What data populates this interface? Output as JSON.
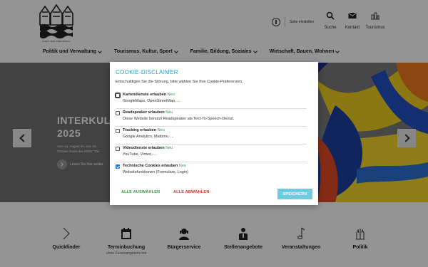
{
  "header": {
    "logo_text": "STADT BAD KREUZNACH",
    "accessibility_label": "Seite einstellen",
    "quick": [
      {
        "label": "Suche",
        "icon": "search-icon"
      },
      {
        "label": "Kontakt",
        "icon": "mail-icon"
      },
      {
        "label": "Tourismus",
        "icon": "tourism-icon"
      }
    ],
    "nav": [
      {
        "label": "Politik und Verwaltung"
      },
      {
        "label": "Tourismus, Kultur, Sport"
      },
      {
        "label": "Familie, Bildung, Soziales"
      },
      {
        "label": "Wirtschaft, Bauen, Wohnen"
      }
    ]
  },
  "hero": {
    "title_line1": "INTERKULT",
    "title_line2": "2025",
    "sub_line1": "Vom 14. August bis zum 10.",
    "sub_line2": "Oktober findet das Motto \"Tan",
    "more_label": "Lesen Sie hier weiter",
    "colors": {
      "yellow": "#f4d21c",
      "blue": "#1d3fa3",
      "red": "#e23a26",
      "orange": "#ef7a1c"
    }
  },
  "bottom_links": [
    {
      "label": "Quickfinder",
      "sub": "",
      "icon": "chevron-right-icon"
    },
    {
      "label": "Terminbuchung",
      "sub": "ohne Zusatzangebots mit",
      "icon": "calendar-icon"
    },
    {
      "label": "Bürgerservice",
      "sub": "",
      "icon": "citizen-icon"
    },
    {
      "label": "Stellenangebote",
      "sub": "",
      "icon": "jobs-icon"
    },
    {
      "label": "Veranstaltungen",
      "sub": "",
      "icon": "music-icon"
    },
    {
      "label": "Politik",
      "sub": "",
      "icon": "politics-icon"
    }
  ],
  "modal": {
    "title": "COOKIE-DISCLAIMER",
    "intro": "Entschuldigen Sie die Störung, bitte wählen Sie Ihre Cookie-Präferenzen.",
    "options": [
      {
        "title": "Kartendienste erlauben",
        "new": "Neu",
        "desc": "GoogleMaps, OpenStreetMap, ...",
        "checked": false
      },
      {
        "title": "Readspeaker erlauben",
        "new": "Neu",
        "desc": "Diese Website benutzt Readspeaker als Text-To-Speech-Dienst.",
        "checked": false
      },
      {
        "title": "Tracking erlauben",
        "new": "Neu",
        "desc": "Google Analytics, Matomo, ...",
        "checked": false
      },
      {
        "title": "Videodienste erlauben",
        "new": "Neu",
        "desc": "YouTube, Vimeo, ...",
        "checked": false
      },
      {
        "title": "Technische Cookies erlauben",
        "new": "Neu",
        "desc": "Websitefunktionen (Formulare, Login)",
        "checked": true
      }
    ],
    "accept_all": "ALLE AUSWÄHLEN",
    "reject_all": "ALLE ABWÄHLEN",
    "save": "SPEICHERN"
  }
}
